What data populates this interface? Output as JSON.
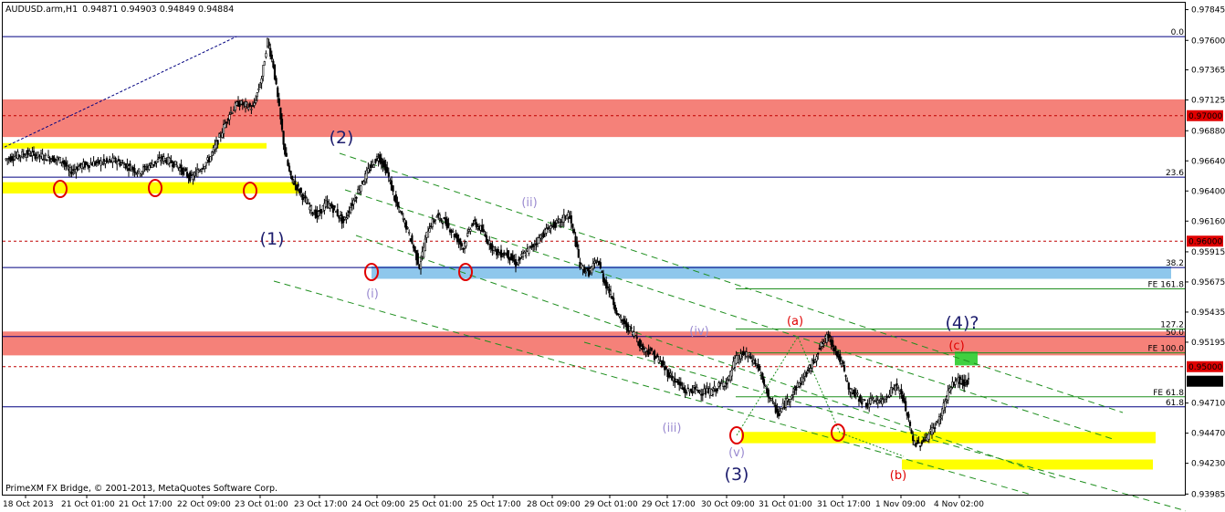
{
  "header": {
    "symbol": "AUDUSD.arm,H1",
    "ohlc": "0.94871 0.94903 0.94849 0.94884"
  },
  "footer": {
    "copyright": "PrimeXM FX Bridge, © 2001-2013, MetaQuotes Software Corp."
  },
  "colors": {
    "background": "#ffffff",
    "candle": "#000000",
    "fib_line": "#000080",
    "red_zone": "#f47a72",
    "yellow_zone": "#ffff00",
    "blue_zone": "#8ec7ec",
    "green_zone": "#40d040",
    "channel": "#1f8f1f",
    "level_dash": "#c00000",
    "wave_primary": "#1e1e6e",
    "wave_minor": "#9a8ad0",
    "wave_correction": "#e00000",
    "price_badge": "#e00000"
  },
  "chart_data": {
    "type": "candlestick",
    "instrument": "AUDUSD.arm",
    "timeframe": "H1",
    "ylim": [
      0.9398,
      0.979
    ],
    "grid": false,
    "x_tick_labels": [
      "18 Oct 2013",
      "21 Oct 01:00",
      "21 Oct 17:00",
      "22 Oct 09:00",
      "23 Oct 01:00",
      "23 Oct 17:00",
      "24 Oct 09:00",
      "25 Oct 01:00",
      "25 Oct 17:00",
      "28 Oct 09:00",
      "29 Oct 01:00",
      "29 Oct 17:00",
      "30 Oct 09:00",
      "31 Oct 01:00",
      "31 Oct 17:00",
      "1 Nov 09:00",
      "4 Nov 02:00"
    ],
    "y_tick_labels": [
      "0.97845",
      "0.97600",
      "0.97365",
      "0.97125",
      "0.96880",
      "0.96640",
      "0.96400",
      "0.96160",
      "0.95915",
      "0.95675",
      "0.95435",
      "0.95195",
      "0.94710",
      "0.94470",
      "0.94230",
      "0.93985"
    ],
    "price_path": [
      [
        0,
        0.9665
      ],
      [
        8,
        0.9668
      ],
      [
        16,
        0.967
      ],
      [
        24,
        0.9668
      ],
      [
        32,
        0.9666
      ],
      [
        40,
        0.9664
      ],
      [
        44,
        0.9655
      ],
      [
        52,
        0.966
      ],
      [
        60,
        0.9662
      ],
      [
        68,
        0.9663
      ],
      [
        76,
        0.9664
      ],
      [
        84,
        0.966
      ],
      [
        92,
        0.9655
      ],
      [
        100,
        0.9661
      ],
      [
        108,
        0.9666
      ],
      [
        116,
        0.9662
      ],
      [
        122,
        0.9656
      ],
      [
        128,
        0.965
      ],
      [
        134,
        0.9658
      ],
      [
        140,
        0.9665
      ],
      [
        148,
        0.9685
      ],
      [
        154,
        0.9702
      ],
      [
        160,
        0.971
      ],
      [
        166,
        0.9708
      ],
      [
        170,
        0.9706
      ],
      [
        176,
        0.973
      ],
      [
        180,
        0.976
      ],
      [
        184,
        0.974
      ],
      [
        188,
        0.9705
      ],
      [
        192,
        0.967
      ],
      [
        196,
        0.965
      ],
      [
        202,
        0.964
      ],
      [
        208,
        0.9628
      ],
      [
        214,
        0.962
      ],
      [
        220,
        0.963
      ],
      [
        226,
        0.9625
      ],
      [
        232,
        0.9615
      ],
      [
        238,
        0.963
      ],
      [
        244,
        0.9645
      ],
      [
        250,
        0.9658
      ],
      [
        256,
        0.9668
      ],
      [
        262,
        0.9655
      ],
      [
        268,
        0.963
      ],
      [
        274,
        0.9615
      ],
      [
        280,
        0.9595
      ],
      [
        284,
        0.958
      ],
      [
        290,
        0.961
      ],
      [
        296,
        0.962
      ],
      [
        302,
        0.9615
      ],
      [
        308,
        0.9605
      ],
      [
        314,
        0.9595
      ],
      [
        320,
        0.9615
      ],
      [
        326,
        0.961
      ],
      [
        332,
        0.9598
      ],
      [
        338,
        0.959
      ],
      [
        344,
        0.959
      ],
      [
        350,
        0.9582
      ],
      [
        356,
        0.959
      ],
      [
        362,
        0.9597
      ],
      [
        368,
        0.9605
      ],
      [
        374,
        0.9612
      ],
      [
        380,
        0.9615
      ],
      [
        386,
        0.9622
      ],
      [
        390,
        0.9605
      ],
      [
        394,
        0.958
      ],
      [
        400,
        0.9575
      ],
      [
        406,
        0.9585
      ],
      [
        410,
        0.957
      ],
      [
        416,
        0.9555
      ],
      [
        420,
        0.954
      ],
      [
        426,
        0.9532
      ],
      [
        432,
        0.9525
      ],
      [
        436,
        0.9515
      ],
      [
        442,
        0.9512
      ],
      [
        448,
        0.9505
      ],
      [
        454,
        0.9495
      ],
      [
        460,
        0.9488
      ],
      [
        466,
        0.948
      ],
      [
        472,
        0.9482
      ],
      [
        478,
        0.948
      ],
      [
        484,
        0.948
      ],
      [
        490,
        0.9485
      ],
      [
        496,
        0.949
      ],
      [
        500,
        0.9505
      ],
      [
        506,
        0.951
      ],
      [
        510,
        0.9508
      ],
      [
        516,
        0.95
      ],
      [
        520,
        0.9485
      ],
      [
        526,
        0.947
      ],
      [
        530,
        0.9462
      ],
      [
        534,
        0.947
      ],
      [
        540,
        0.948
      ],
      [
        546,
        0.949
      ],
      [
        552,
        0.95
      ],
      [
        558,
        0.9515
      ],
      [
        564,
        0.9525
      ],
      [
        568,
        0.9515
      ],
      [
        574,
        0.95
      ],
      [
        578,
        0.9482
      ],
      [
        584,
        0.9476
      ],
      [
        590,
        0.947
      ],
      [
        596,
        0.9474
      ],
      [
        600,
        0.9472
      ],
      [
        606,
        0.948
      ],
      [
        610,
        0.9485
      ],
      [
        614,
        0.9478
      ],
      [
        618,
        0.9462
      ],
      [
        622,
        0.944
      ],
      [
        626,
        0.9438
      ],
      [
        630,
        0.9442
      ],
      [
        634,
        0.9448
      ],
      [
        640,
        0.9458
      ],
      [
        646,
        0.948
      ],
      [
        652,
        0.949
      ],
      [
        656,
        0.9487
      ],
      [
        660,
        0.9488
      ]
    ],
    "levels": [
      {
        "kind": "fib_retracement",
        "label": "0.0",
        "price": 0.9763
      },
      {
        "kind": "fib_retracement",
        "label": "23.6",
        "price": 0.9651
      },
      {
        "kind": "fib_retracement",
        "label": "38.2",
        "price": 0.9579
      },
      {
        "kind": "fib_retracement",
        "label": "50.0",
        "price": 0.9524
      },
      {
        "kind": "fib_retracement",
        "label": "61.8",
        "price": 0.9468
      },
      {
        "kind": "fib_extension",
        "label": "FE 161.8",
        "price": 0.9562
      },
      {
        "kind": "fib_extension",
        "label": "127.2",
        "price": 0.953
      },
      {
        "kind": "fib_extension",
        "label": "FE 100.0",
        "price": 0.9511
      },
      {
        "kind": "fib_extension",
        "label": "FE 61.8",
        "price": 0.9476
      },
      {
        "kind": "dashed_level",
        "label": "0.97000",
        "price": 0.97
      },
      {
        "kind": "dashed_level",
        "label": "0.96000",
        "price": 0.96
      },
      {
        "kind": "dashed_level",
        "label": "0.95000",
        "price": 0.95
      }
    ],
    "current_price": "0.94884",
    "zones": [
      {
        "color": "red",
        "price_top": 0.9713,
        "price_bottom": 0.9683
      },
      {
        "color": "red",
        "price_top": 0.9528,
        "price_bottom": 0.9509
      },
      {
        "color": "yellow",
        "price_top": 0.9676,
        "price_bottom": 0.9674
      },
      {
        "color": "yellow",
        "price_top": 0.9647,
        "price_bottom": 0.9638
      },
      {
        "color": "blue",
        "price_top": 0.958,
        "price_bottom": 0.957
      },
      {
        "color": "yellow",
        "price_top": 0.9448,
        "price_bottom": 0.9439
      },
      {
        "color": "yellow",
        "price_top": 0.9426,
        "price_bottom": 0.9418
      },
      {
        "color": "green",
        "price_top": 0.9512,
        "price_bottom": 0.9501
      }
    ],
    "wave_labels": [
      {
        "text": "(1)",
        "group": "primary"
      },
      {
        "text": "(2)",
        "group": "primary"
      },
      {
        "text": "(3)",
        "group": "primary"
      },
      {
        "text": "(4)?",
        "group": "primary"
      },
      {
        "text": "(i)",
        "group": "minor"
      },
      {
        "text": "(ii)",
        "group": "minor"
      },
      {
        "text": "(iii)",
        "group": "minor"
      },
      {
        "text": "(iv)",
        "group": "minor"
      },
      {
        "text": "(v)",
        "group": "minor"
      },
      {
        "text": "(a)",
        "group": "correction"
      },
      {
        "text": "(b)",
        "group": "correction"
      },
      {
        "text": "(c)",
        "group": "correction"
      }
    ]
  }
}
